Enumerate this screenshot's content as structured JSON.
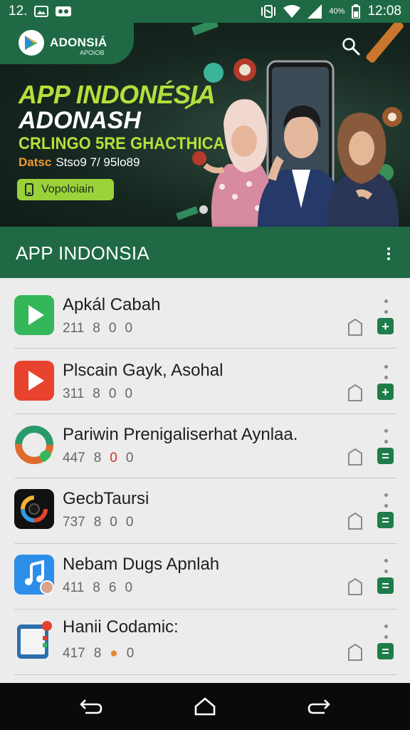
{
  "status_bar": {
    "time_left": "12.",
    "wifi_label": "%",
    "battery_label": "40%",
    "time": "12:08"
  },
  "banner": {
    "brand_name": "ADONSIÁ",
    "brand_sub": "APOIOB",
    "headline_1": "APP INDONÉSIA",
    "headline_2": "ADONASH",
    "headline_3": "CRLINGO 5RE GHACTHICA",
    "date_label": "Datsc",
    "date_value": "Stso9 7/ 95lo89",
    "cta_label": "Vopoloiain"
  },
  "header": {
    "title": "APP INDONSIA"
  },
  "apps": [
    {
      "name": "Apkál Cabah",
      "stats": [
        "211",
        "8",
        "0",
        "0"
      ],
      "action": "+"
    },
    {
      "name": "Plscain Gayk, Asohal",
      "stats": [
        "311",
        "8",
        "0",
        "0"
      ],
      "action": "+"
    },
    {
      "name": "Pariwin Prenigaliserhat Aynlaa.",
      "stats": [
        "447",
        "8",
        "0",
        "0"
      ],
      "action": "="
    },
    {
      "name": "GecbTaursi",
      "stats": [
        "737",
        "8",
        "0",
        "0"
      ],
      "action": "="
    },
    {
      "name": "Nebam Dugs Apnlah",
      "stats": [
        "411",
        "8",
        "6",
        "0"
      ],
      "action": "="
    },
    {
      "name": "Hanii Codamic:",
      "stats": [
        "417",
        "8",
        "",
        "0"
      ],
      "action": "="
    }
  ],
  "colors": {
    "primary": "#1f6a45",
    "accent_green": "#b6de3c",
    "action_green": "#1f7d4a",
    "date_orange": "#f29a2e"
  }
}
